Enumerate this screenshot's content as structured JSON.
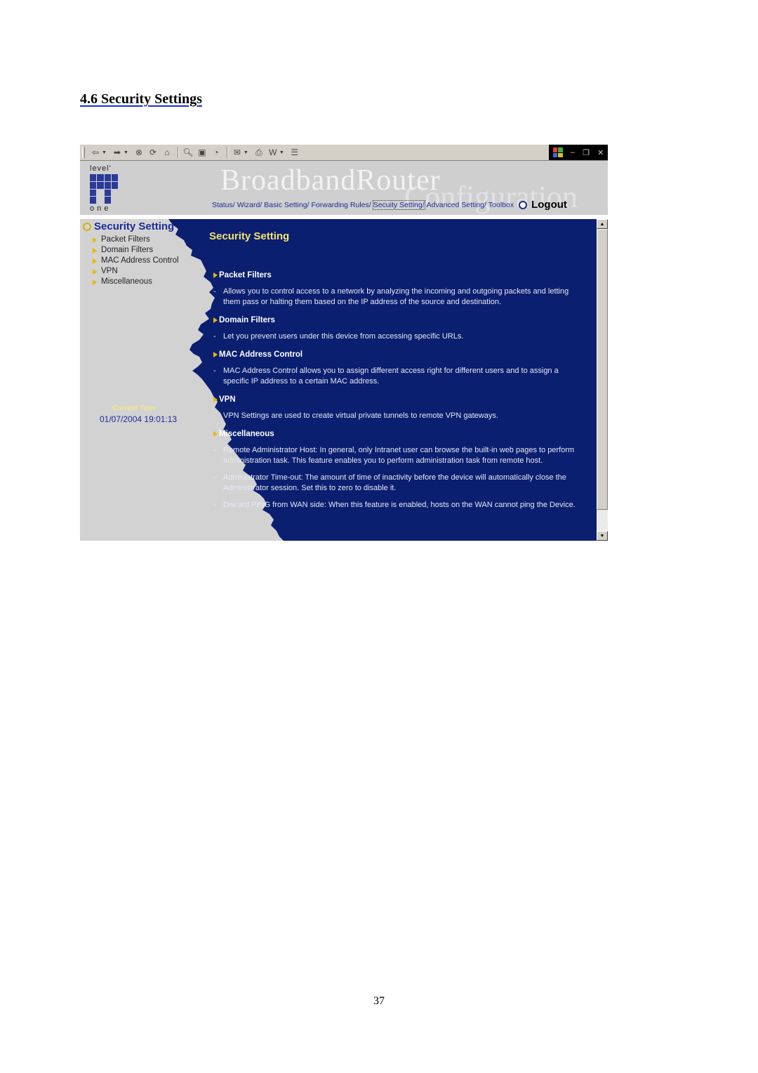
{
  "document": {
    "heading": "4.6 Security Settings",
    "page_number": "37"
  },
  "browser": {
    "toolbar_icons": [
      "back-icon",
      "forward-icon",
      "stop-icon",
      "refresh-icon",
      "home-icon",
      "search-icon",
      "favorites-icon",
      "history-icon",
      "mail-icon",
      "print-icon",
      "edit-icon",
      "discuss-icon"
    ],
    "window_controls": [
      "windows-logo-icon",
      "minimize-icon",
      "restore-icon",
      "close-icon"
    ]
  },
  "header": {
    "logo_top": "level'",
    "logo_bottom": "one",
    "brand_title": "BroadbandRouter",
    "brand_subtitle": "Configuration",
    "nav": [
      {
        "label": "Status/"
      },
      {
        "label": "Wizard/"
      },
      {
        "label": "Basic Setting/"
      },
      {
        "label": "Forwarding Rules/"
      },
      {
        "label": "Secuity Setting/",
        "active": true
      },
      {
        "label": "Advanced Setting/"
      },
      {
        "label": "Toolbox"
      }
    ],
    "logout_label": "Logout"
  },
  "sidebar": {
    "title": "Security Setting",
    "items": [
      {
        "label": "Packet Filters"
      },
      {
        "label": "Domain Filters"
      },
      {
        "label": "MAC Address Control"
      },
      {
        "label": "VPN"
      },
      {
        "label": "Miscellaneous"
      }
    ],
    "current_time_label": "Current Time",
    "current_time_value": "01/07/2004 19:01:13"
  },
  "main": {
    "title": "Security Setting",
    "sections": [
      {
        "heading": "Packet Filters",
        "descriptions": [
          "Allows you to control access to a network by analyzing the incoming and outgoing packets and letting them pass or halting them based on the IP address of the source and destination."
        ]
      },
      {
        "heading": "Domain Filters",
        "descriptions": [
          "Let you prevent users under this device from accessing specific URLs."
        ]
      },
      {
        "heading": "MAC Address Control",
        "descriptions": [
          "MAC Address Control allows you to assign different access right for different users and to assign a specific IP address to a certain MAC address."
        ]
      },
      {
        "heading": "VPN",
        "descriptions": [
          "VPN Settings are used to create virtual private tunnels to remote VPN gateways."
        ]
      },
      {
        "heading": "Miscellaneous",
        "descriptions": [
          "Remote Administrator Host: In general, only Intranet user can browse the built-in web pages to perform administration task. This feature enables you to perform administration task from remote host.",
          "Administrator Time-out: The amount of time of inactivity before the device will automatically close the Administrator session. Set this to zero to disable it.",
          "Discard PING from WAN side: When this feature is enabled, hosts on the WAN cannot ping the Device."
        ]
      }
    ],
    "dash": "-"
  },
  "colors": {
    "content_bg": "#0b1f70",
    "sidebar_bg": "#cfcfcf",
    "title_yellow": "#f4e470",
    "link_blue": "#1a2b9a"
  }
}
